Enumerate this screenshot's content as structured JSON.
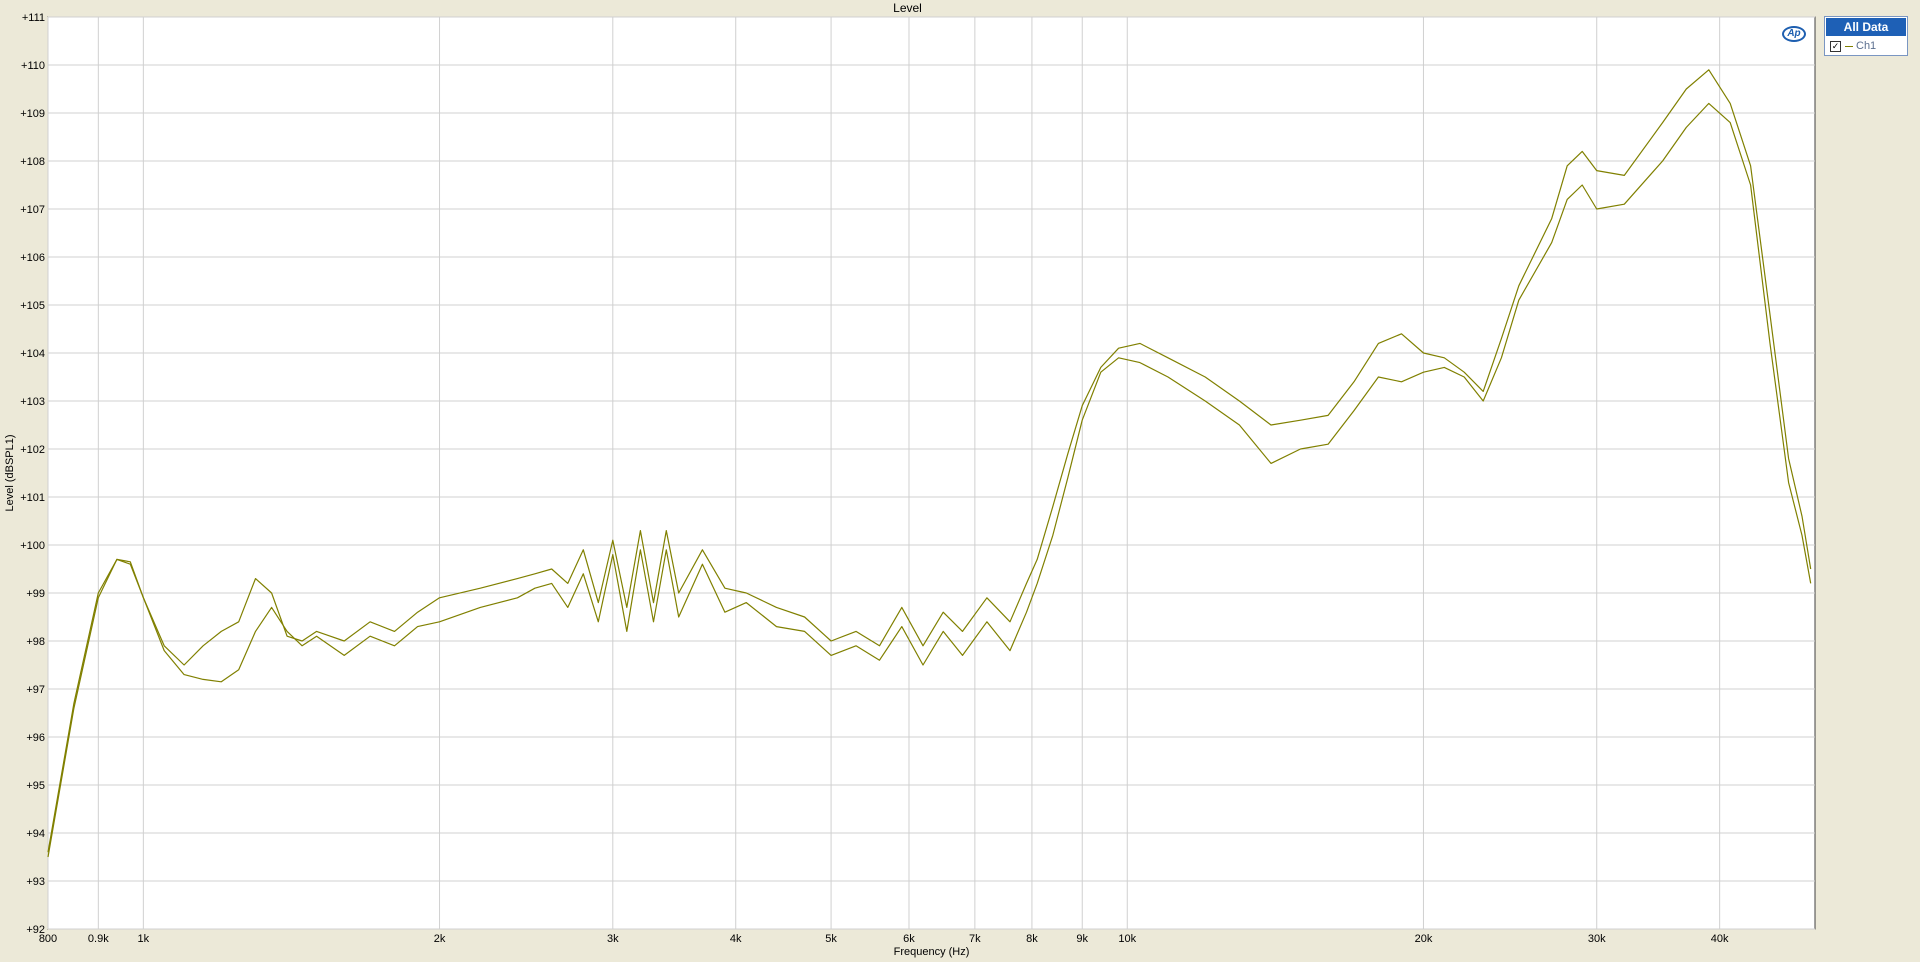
{
  "chart_data": {
    "type": "line",
    "title": "Level",
    "xlabel": "Frequency (Hz)",
    "ylabel": "Level (dBSPL1)",
    "xscale": "log",
    "xlim": [
      800,
      50000
    ],
    "ylim": [
      92,
      111
    ],
    "grid": true,
    "legend": "top-right",
    "x_ticks": [
      {
        "value": 800,
        "label": "800"
      },
      {
        "value": 900,
        "label": "0.9k"
      },
      {
        "value": 1000,
        "label": "1k"
      },
      {
        "value": 2000,
        "label": "2k"
      },
      {
        "value": 3000,
        "label": "3k"
      },
      {
        "value": 4000,
        "label": "4k"
      },
      {
        "value": 5000,
        "label": "5k"
      },
      {
        "value": 6000,
        "label": "6k"
      },
      {
        "value": 7000,
        "label": "7k"
      },
      {
        "value": 8000,
        "label": "8k"
      },
      {
        "value": 9000,
        "label": "9k"
      },
      {
        "value": 10000,
        "label": "10k"
      },
      {
        "value": 20000,
        "label": "20k"
      },
      {
        "value": 30000,
        "label": "30k"
      },
      {
        "value": 40000,
        "label": "40k"
      }
    ],
    "y_ticks": [
      {
        "value": 92,
        "label": "+92"
      },
      {
        "value": 93,
        "label": "+93"
      },
      {
        "value": 94,
        "label": "+94"
      },
      {
        "value": 95,
        "label": "+95"
      },
      {
        "value": 96,
        "label": "+96"
      },
      {
        "value": 97,
        "label": "+97"
      },
      {
        "value": 98,
        "label": "+98"
      },
      {
        "value": 99,
        "label": "+99"
      },
      {
        "value": 100,
        "label": "+100"
      },
      {
        "value": 101,
        "label": "+101"
      },
      {
        "value": 102,
        "label": "+102"
      },
      {
        "value": 103,
        "label": "+103"
      },
      {
        "value": 104,
        "label": "+104"
      },
      {
        "value": 105,
        "label": "+105"
      },
      {
        "value": 106,
        "label": "+106"
      },
      {
        "value": 107,
        "label": "+107"
      },
      {
        "value": 108,
        "label": "+108"
      },
      {
        "value": 109,
        "label": "+109"
      },
      {
        "value": 110,
        "label": "+110"
      },
      {
        "value": 111,
        "label": "+111"
      }
    ],
    "series": [
      {
        "color": "#808000",
        "points": [
          [
            800,
            93.5
          ],
          [
            850,
            96.6
          ],
          [
            900,
            98.9
          ],
          [
            940,
            99.7
          ],
          [
            970,
            99.6
          ],
          [
            1000,
            98.9
          ],
          [
            1050,
            97.8
          ],
          [
            1100,
            97.3
          ],
          [
            1150,
            97.2
          ],
          [
            1200,
            97.15
          ],
          [
            1250,
            97.4
          ],
          [
            1300,
            98.2
          ],
          [
            1350,
            98.7
          ],
          [
            1400,
            98.2
          ],
          [
            1450,
            97.9
          ],
          [
            1500,
            98.1
          ],
          [
            1600,
            97.7
          ],
          [
            1700,
            98.1
          ],
          [
            1800,
            97.9
          ],
          [
            1900,
            98.3
          ],
          [
            2000,
            98.4
          ],
          [
            2200,
            98.7
          ],
          [
            2400,
            98.9
          ],
          [
            2500,
            99.1
          ],
          [
            2600,
            99.2
          ],
          [
            2700,
            98.7
          ],
          [
            2800,
            99.4
          ],
          [
            2900,
            98.4
          ],
          [
            3000,
            99.8
          ],
          [
            3100,
            98.2
          ],
          [
            3200,
            99.9
          ],
          [
            3300,
            98.4
          ],
          [
            3400,
            99.9
          ],
          [
            3500,
            98.5
          ],
          [
            3700,
            99.6
          ],
          [
            3900,
            98.6
          ],
          [
            4100,
            98.8
          ],
          [
            4400,
            98.3
          ],
          [
            4700,
            98.2
          ],
          [
            5000,
            97.7
          ],
          [
            5300,
            97.9
          ],
          [
            5600,
            97.6
          ],
          [
            5900,
            98.3
          ],
          [
            6200,
            97.5
          ],
          [
            6500,
            98.2
          ],
          [
            6800,
            97.7
          ],
          [
            7200,
            98.4
          ],
          [
            7600,
            97.8
          ],
          [
            7900,
            98.6
          ],
          [
            8100,
            99.2
          ],
          [
            8400,
            100.2
          ],
          [
            8700,
            101.4
          ],
          [
            9000,
            102.6
          ],
          [
            9400,
            103.6
          ],
          [
            9800,
            103.9
          ],
          [
            10300,
            103.8
          ],
          [
            11000,
            103.5
          ],
          [
            12000,
            103.0
          ],
          [
            13000,
            102.5
          ],
          [
            14000,
            101.7
          ],
          [
            15000,
            102.0
          ],
          [
            16000,
            102.1
          ],
          [
            17000,
            102.8
          ],
          [
            18000,
            103.5
          ],
          [
            19000,
            103.4
          ],
          [
            20000,
            103.6
          ],
          [
            21000,
            103.7
          ],
          [
            22000,
            103.5
          ],
          [
            23000,
            103.0
          ],
          [
            24000,
            103.9
          ],
          [
            25000,
            105.1
          ],
          [
            27000,
            106.3
          ],
          [
            28000,
            107.2
          ],
          [
            29000,
            107.5
          ],
          [
            30000,
            107.0
          ],
          [
            32000,
            107.1
          ],
          [
            35000,
            108.0
          ],
          [
            37000,
            108.7
          ],
          [
            39000,
            109.2
          ],
          [
            41000,
            108.8
          ],
          [
            43000,
            107.5
          ],
          [
            45000,
            104.2
          ],
          [
            47000,
            101.3
          ],
          [
            48500,
            100.2
          ],
          [
            49500,
            99.2
          ]
        ]
      },
      {
        "color": "#808000",
        "points": [
          [
            800,
            93.6
          ],
          [
            850,
            96.7
          ],
          [
            900,
            99.0
          ],
          [
            940,
            99.7
          ],
          [
            970,
            99.65
          ],
          [
            1000,
            98.9
          ],
          [
            1050,
            97.9
          ],
          [
            1100,
            97.5
          ],
          [
            1150,
            97.9
          ],
          [
            1200,
            98.2
          ],
          [
            1250,
            98.4
          ],
          [
            1300,
            99.3
          ],
          [
            1350,
            99.0
          ],
          [
            1400,
            98.1
          ],
          [
            1450,
            98.0
          ],
          [
            1500,
            98.2
          ],
          [
            1600,
            98.0
          ],
          [
            1700,
            98.4
          ],
          [
            1800,
            98.2
          ],
          [
            1900,
            98.6
          ],
          [
            2000,
            98.9
          ],
          [
            2200,
            99.1
          ],
          [
            2400,
            99.3
          ],
          [
            2500,
            99.4
          ],
          [
            2600,
            99.5
          ],
          [
            2700,
            99.2
          ],
          [
            2800,
            99.9
          ],
          [
            2900,
            98.8
          ],
          [
            3000,
            100.1
          ],
          [
            3100,
            98.7
          ],
          [
            3200,
            100.3
          ],
          [
            3300,
            98.8
          ],
          [
            3400,
            100.3
          ],
          [
            3500,
            99.0
          ],
          [
            3700,
            99.9
          ],
          [
            3900,
            99.1
          ],
          [
            4100,
            99.0
          ],
          [
            4400,
            98.7
          ],
          [
            4700,
            98.5
          ],
          [
            5000,
            98.0
          ],
          [
            5300,
            98.2
          ],
          [
            5600,
            97.9
          ],
          [
            5900,
            98.7
          ],
          [
            6200,
            97.9
          ],
          [
            6500,
            98.6
          ],
          [
            6800,
            98.2
          ],
          [
            7200,
            98.9
          ],
          [
            7600,
            98.4
          ],
          [
            7900,
            99.2
          ],
          [
            8100,
            99.7
          ],
          [
            8400,
            100.8
          ],
          [
            8700,
            101.9
          ],
          [
            9000,
            102.9
          ],
          [
            9400,
            103.7
          ],
          [
            9800,
            104.1
          ],
          [
            10300,
            104.2
          ],
          [
            11000,
            103.9
          ],
          [
            12000,
            103.5
          ],
          [
            13000,
            103.0
          ],
          [
            14000,
            102.5
          ],
          [
            15000,
            102.6
          ],
          [
            16000,
            102.7
          ],
          [
            17000,
            103.4
          ],
          [
            18000,
            104.2
          ],
          [
            19000,
            104.4
          ],
          [
            20000,
            104.0
          ],
          [
            21000,
            103.9
          ],
          [
            22000,
            103.6
          ],
          [
            23000,
            103.2
          ],
          [
            24000,
            104.3
          ],
          [
            25000,
            105.4
          ],
          [
            27000,
            106.8
          ],
          [
            28000,
            107.9
          ],
          [
            29000,
            108.2
          ],
          [
            30000,
            107.8
          ],
          [
            32000,
            107.7
          ],
          [
            35000,
            108.8
          ],
          [
            37000,
            109.5
          ],
          [
            39000,
            109.9
          ],
          [
            41000,
            109.2
          ],
          [
            43000,
            107.9
          ],
          [
            45000,
            104.8
          ],
          [
            47000,
            101.8
          ],
          [
            48500,
            100.6
          ],
          [
            49500,
            99.5
          ]
        ]
      }
    ]
  },
  "legend": {
    "header": "All Data",
    "item_label": "Ch1",
    "checked": true,
    "check_glyph": "✓"
  },
  "logo": {
    "text": "Ap"
  }
}
